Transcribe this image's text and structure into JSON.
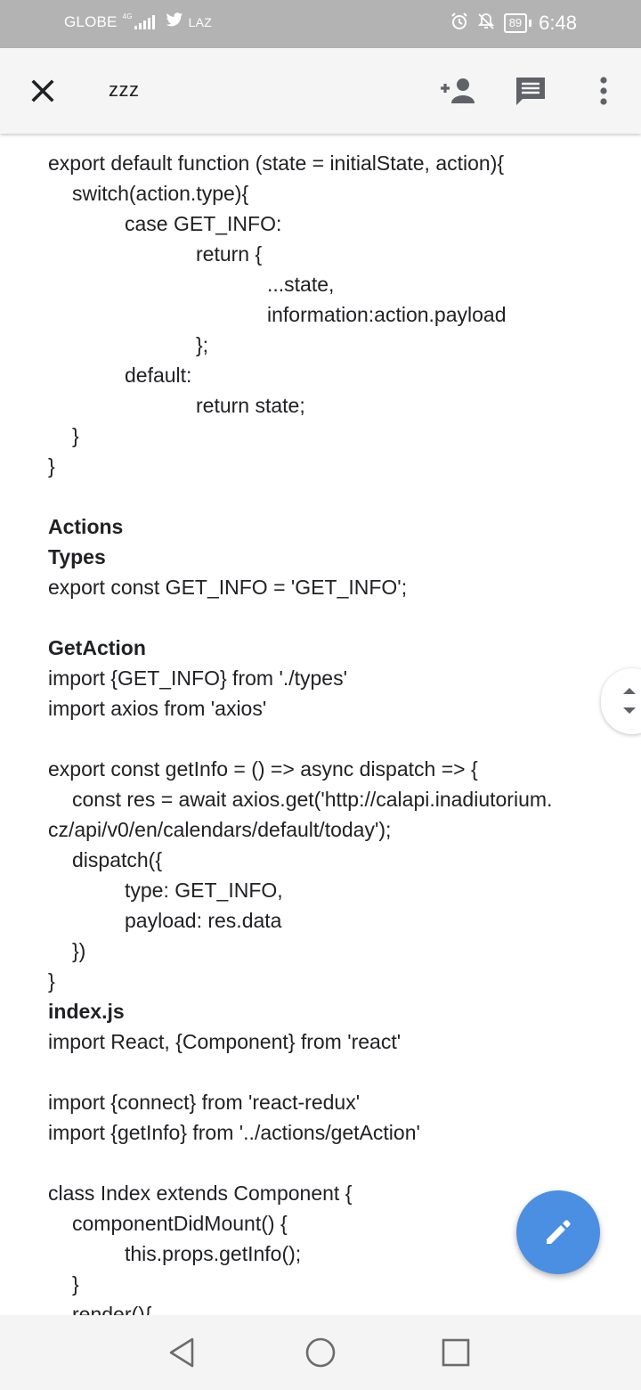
{
  "status_bar": {
    "carrier": "GLOBE",
    "network": "4G",
    "app_label": "LAZ",
    "battery": "89",
    "time": "6:48"
  },
  "app_bar": {
    "title": "zzz"
  },
  "document": {
    "lines": [
      {
        "indent": 0,
        "bold": false,
        "text": "export default function (state = initialState, action){"
      },
      {
        "indent": 1,
        "bold": false,
        "text": "switch(action.type){"
      },
      {
        "indent": 2,
        "bold": false,
        "text": "case GET_INFO:"
      },
      {
        "indent": 3,
        "bold": false,
        "text": "return {"
      },
      {
        "indent": 4,
        "bold": false,
        "text": "...state,"
      },
      {
        "indent": 4,
        "bold": false,
        "text": "information:action.payload"
      },
      {
        "indent": 3,
        "bold": false,
        "text": "};"
      },
      {
        "indent": 2,
        "bold": false,
        "text": "default:"
      },
      {
        "indent": 3,
        "bold": false,
        "text": "return state;"
      },
      {
        "indent": 1,
        "bold": false,
        "text": "}"
      },
      {
        "indent": 0,
        "bold": false,
        "text": "}"
      },
      {
        "indent": 0,
        "bold": false,
        "text": ""
      },
      {
        "indent": 0,
        "bold": true,
        "text": "Actions"
      },
      {
        "indent": 0,
        "bold": true,
        "text": "Types"
      },
      {
        "indent": 0,
        "bold": false,
        "text": "export const GET_INFO = 'GET_INFO';"
      },
      {
        "indent": 0,
        "bold": false,
        "text": ""
      },
      {
        "indent": 0,
        "bold": true,
        "text": "GetAction"
      },
      {
        "indent": 0,
        "bold": false,
        "text": "import {GET_INFO} from './types'"
      },
      {
        "indent": 0,
        "bold": false,
        "text": "import axios from 'axios'"
      },
      {
        "indent": 0,
        "bold": false,
        "text": ""
      },
      {
        "indent": 0,
        "bold": false,
        "text": "export const getInfo = () => async dispatch => {"
      },
      {
        "indent": 1,
        "bold": false,
        "text": "const res = await axios.get('http://calapi.inadiutorium."
      },
      {
        "indent": 0,
        "bold": false,
        "text": "cz/api/v0/en/calendars/default/today');"
      },
      {
        "indent": 1,
        "bold": false,
        "text": "dispatch({"
      },
      {
        "indent": 2,
        "bold": false,
        "text": "type: GET_INFO,"
      },
      {
        "indent": 2,
        "bold": false,
        "text": "payload: res.data"
      },
      {
        "indent": 1,
        "bold": false,
        "text": "})"
      },
      {
        "indent": 0,
        "bold": false,
        "text": "}"
      },
      {
        "indent": 0,
        "bold": true,
        "text": "index.js"
      },
      {
        "indent": 0,
        "bold": false,
        "text": "import React, {Component} from 'react'"
      },
      {
        "indent": 0,
        "bold": false,
        "text": ""
      },
      {
        "indent": 0,
        "bold": false,
        "text": "import {connect} from 'react-redux'"
      },
      {
        "indent": 0,
        "bold": false,
        "text": "import {getInfo} from '../actions/getAction'"
      },
      {
        "indent": 0,
        "bold": false,
        "text": ""
      },
      {
        "indent": 0,
        "bold": false,
        "text": "class Index extends Component {"
      },
      {
        "indent": 1,
        "bold": false,
        "text": "componentDidMount() {"
      },
      {
        "indent": 2,
        "bold": false,
        "text": "this.props.getInfo();"
      },
      {
        "indent": 1,
        "bold": false,
        "text": "}"
      },
      {
        "indent": 1,
        "bold": false,
        "text": "render(){"
      }
    ]
  },
  "icons": {
    "close": "close-icon",
    "add_person": "add-person-icon",
    "comment": "comment-icon",
    "more": "more-vert-icon",
    "edit": "pencil-icon",
    "scroll": "scroll-handle-icon",
    "back": "nav-back-icon",
    "home": "nav-home-icon",
    "recents": "nav-recents-icon"
  },
  "colors": {
    "status_bar": "#b3b3b3",
    "app_bar": "#f5f5f5",
    "fab": "#4a8fe2",
    "text": "#202124"
  }
}
